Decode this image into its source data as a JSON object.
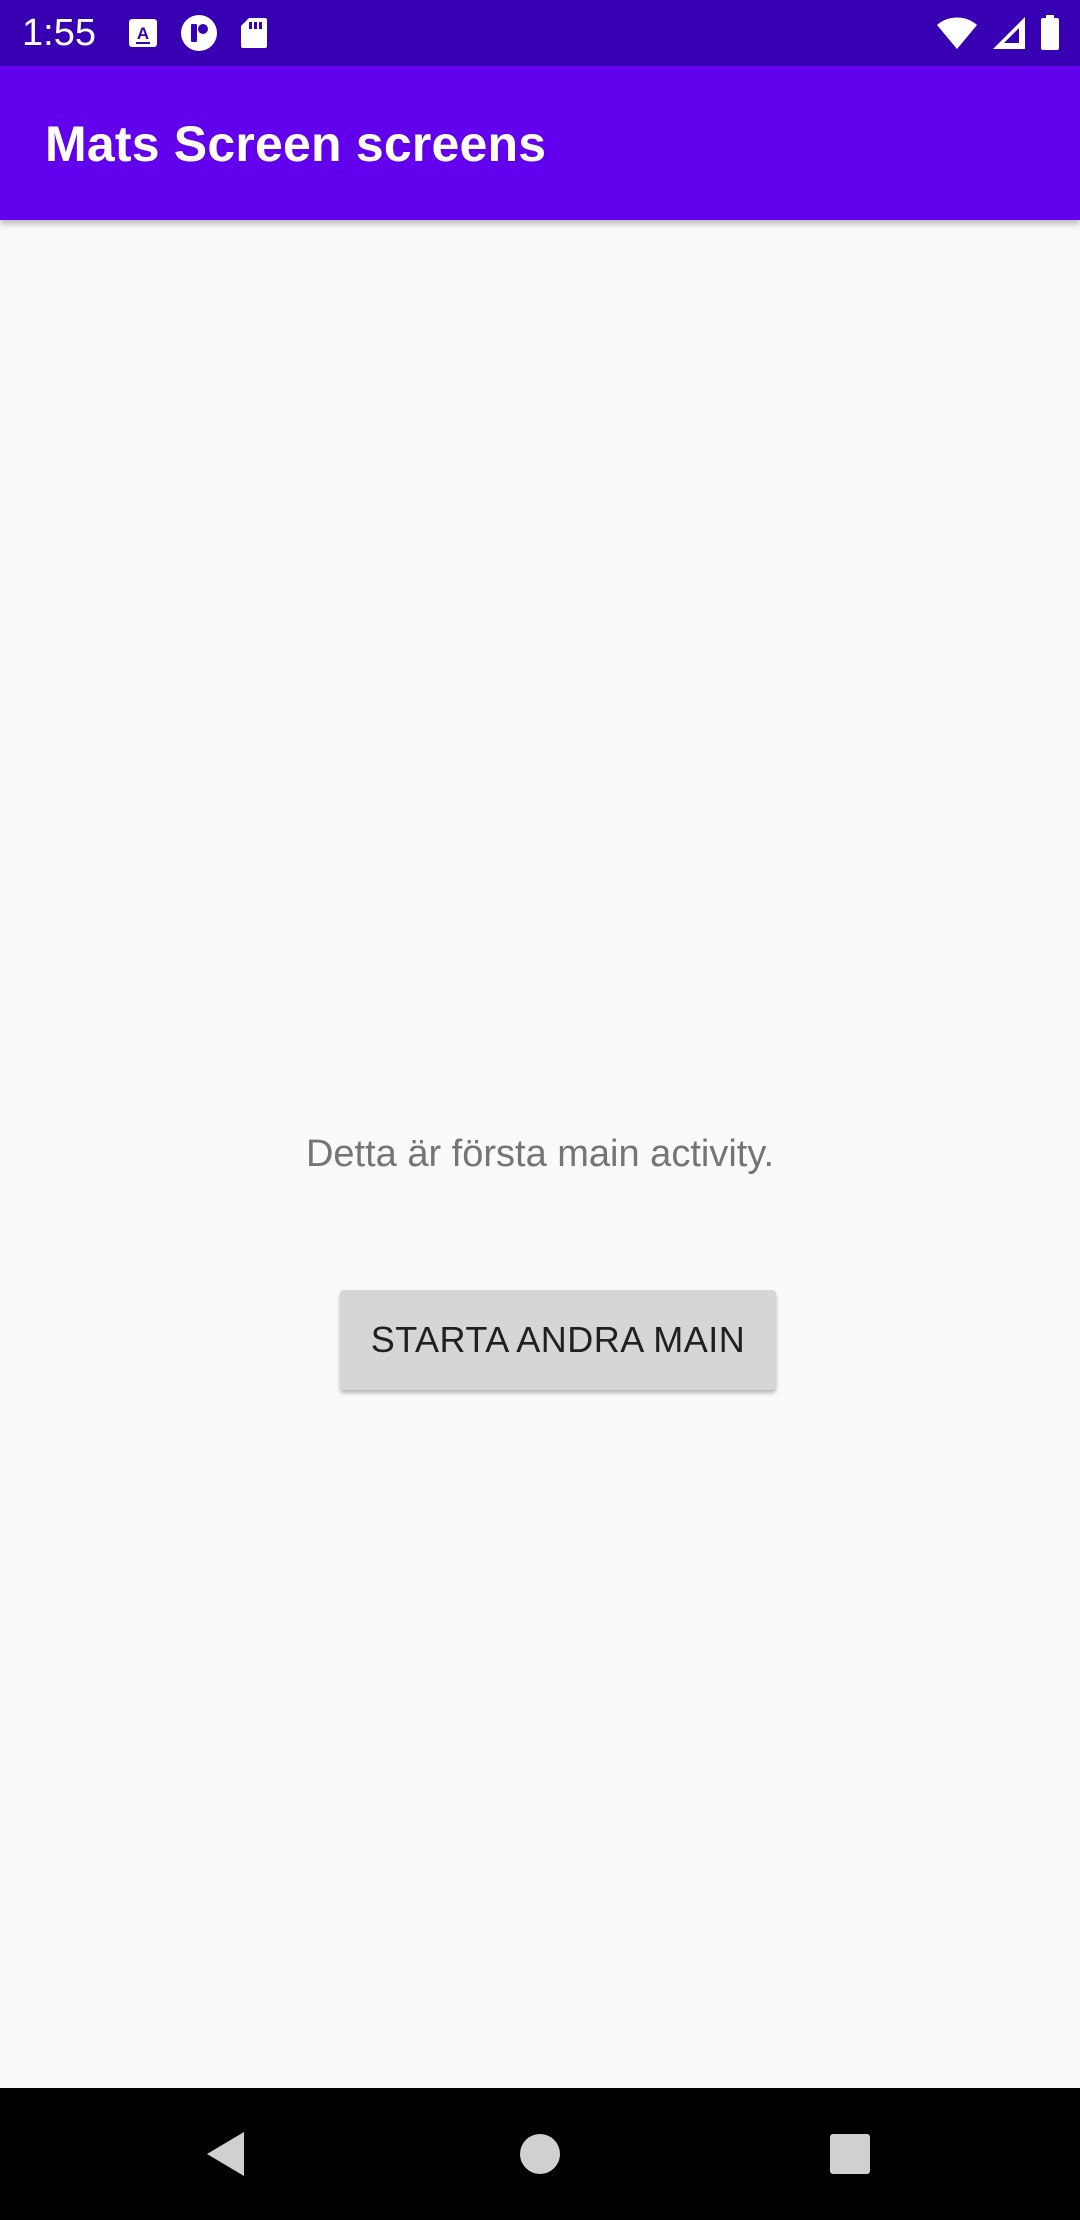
{
  "status_bar": {
    "time": "1:55",
    "left_icons": [
      "font-download-icon",
      "app-notification-icon",
      "sd-card-icon"
    ],
    "right_icons": [
      "wifi-icon",
      "cellular-signal-icon",
      "battery-icon"
    ],
    "background_color": "#3700b3"
  },
  "app_bar": {
    "title": "Mats Screen screens",
    "background_color": "#6200ee"
  },
  "main": {
    "message": "Detta är första main activity.",
    "start_button_label": "STARTA ANDRA MAIN"
  },
  "nav_bar": {
    "buttons": [
      "back-icon",
      "home-icon",
      "recents-icon"
    ]
  }
}
